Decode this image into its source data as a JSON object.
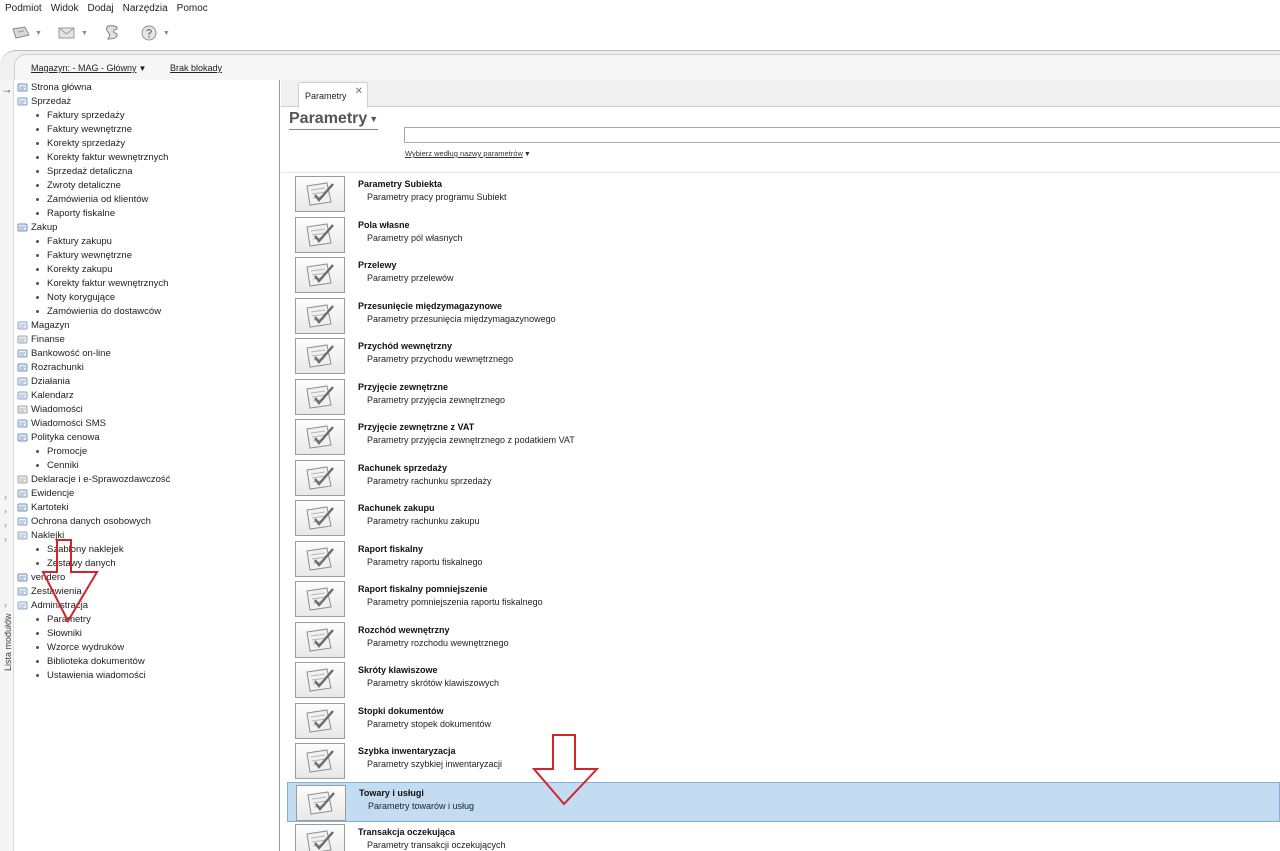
{
  "menu": [
    "Podmiot",
    "Widok",
    "Dodaj",
    "Narzędzia",
    "Pomoc"
  ],
  "toolbar": {
    "buttons": [
      {
        "icon": "document-arrow-icon",
        "has_caret": true
      },
      {
        "icon": "envelope-icon",
        "has_caret": true
      },
      {
        "icon": "scroll-icon",
        "has_caret": false
      },
      {
        "icon": "help-question-icon",
        "has_caret": true
      }
    ]
  },
  "status": {
    "warehouse": "Magazyn: - MAG - Główny",
    "lock": "Brak blokady"
  },
  "sidebar": {
    "vertical_label": "Lista modułów",
    "tree": [
      {
        "label": "Strona główna",
        "level": 0,
        "icon": "home-icon"
      },
      {
        "label": "Sprzedaż",
        "level": 0,
        "icon": "sales-icon"
      },
      {
        "label": "Faktury sprzedaży",
        "level": 1
      },
      {
        "label": "Faktury wewnętrzne",
        "level": 1
      },
      {
        "label": "Korekty sprzedaży",
        "level": 1
      },
      {
        "label": "Korekty faktur wewnętrznych",
        "level": 1
      },
      {
        "label": "Sprzedaż detaliczna",
        "level": 1
      },
      {
        "label": "Zwroty detaliczne",
        "level": 1
      },
      {
        "label": "Zamówienia od klientów",
        "level": 1
      },
      {
        "label": "Raporty fiskalne",
        "level": 1
      },
      {
        "label": "Zakup",
        "level": 0,
        "icon": "purchase-icon"
      },
      {
        "label": "Faktury zakupu",
        "level": 1
      },
      {
        "label": "Faktury wewnętrzne",
        "level": 1
      },
      {
        "label": "Korekty zakupu",
        "level": 1
      },
      {
        "label": "Korekty faktur wewnętrznych",
        "level": 1
      },
      {
        "label": "Noty korygujące",
        "level": 1
      },
      {
        "label": "Zamówienia do dostawców",
        "level": 1
      },
      {
        "label": "Magazyn",
        "level": 0,
        "icon": "warehouse-icon"
      },
      {
        "label": "Finanse",
        "level": 0,
        "icon": "finance-icon"
      },
      {
        "label": "Bankowość on-line",
        "level": 0,
        "icon": "bank-icon"
      },
      {
        "label": "Rozrachunki",
        "level": 0,
        "icon": "settlements-icon"
      },
      {
        "label": "Działania",
        "level": 0,
        "icon": "actions-icon"
      },
      {
        "label": "Kalendarz",
        "level": 0,
        "icon": "calendar-icon"
      },
      {
        "label": "Wiadomości",
        "level": 0,
        "icon": "messages-icon"
      },
      {
        "label": "Wiadomości SMS",
        "level": 0,
        "icon": "sms-icon"
      },
      {
        "label": "Polityka cenowa",
        "level": 0,
        "icon": "pricing-icon"
      },
      {
        "label": "Promocje",
        "level": 1
      },
      {
        "label": "Cenniki",
        "level": 1
      },
      {
        "label": "Deklaracje i e-Sprawozdawczość",
        "level": 0,
        "icon": "declarations-icon"
      },
      {
        "label": "Ewidencje",
        "level": 0,
        "icon": "records-icon"
      },
      {
        "label": "Kartoteki",
        "level": 0,
        "icon": "files-icon"
      },
      {
        "label": "Ochrona danych osobowych",
        "level": 0,
        "icon": "shield-icon"
      },
      {
        "label": "Naklejki",
        "level": 0,
        "icon": "stickers-icon"
      },
      {
        "label": "Szablony naklejek",
        "level": 1
      },
      {
        "label": "Zestawy danych",
        "level": 1
      },
      {
        "label": "vendero",
        "level": 0,
        "icon": "vendero-icon"
      },
      {
        "label": "Zestawienia",
        "level": 0,
        "icon": "reports-icon"
      },
      {
        "label": "Administracja",
        "level": 0,
        "icon": "admin-icon"
      },
      {
        "label": "Parametry",
        "level": 1
      },
      {
        "label": "Słowniki",
        "level": 1
      },
      {
        "label": "Wzorce wydruków",
        "level": 1
      },
      {
        "label": "Biblioteka dokumentów",
        "level": 1
      },
      {
        "label": "Ustawienia wiadomości",
        "level": 1
      }
    ]
  },
  "main": {
    "tab_label": "Parametry",
    "title": "Parametry",
    "search_value": "",
    "filter_label": "Wybierz według nazwy parametrów",
    "selected_index": 15,
    "parameters": [
      {
        "name": "Parametry Subiekta",
        "desc": "Parametry pracy programu Subiekt"
      },
      {
        "name": "Pola własne",
        "desc": "Parametry pól własnych"
      },
      {
        "name": "Przelewy",
        "desc": "Parametry przelewów"
      },
      {
        "name": "Przesunięcie międzymagazynowe",
        "desc": "Parametry przesunięcia międzymagazynowego"
      },
      {
        "name": "Przychód wewnętrzny",
        "desc": "Parametry przychodu wewnętrznego"
      },
      {
        "name": "Przyjęcie zewnętrzne",
        "desc": "Parametry przyjęcia zewnętrznego"
      },
      {
        "name": "Przyjęcie zewnętrzne z VAT",
        "desc": "Parametry przyjęcia zewnętrznego z podatkiem VAT"
      },
      {
        "name": "Rachunek sprzedaży",
        "desc": "Parametry rachunku sprzedaży"
      },
      {
        "name": "Rachunek zakupu",
        "desc": "Parametry rachunku zakupu"
      },
      {
        "name": "Raport fiskalny",
        "desc": "Parametry raportu fiskalnego"
      },
      {
        "name": "Raport fiskalny pomniejszenie",
        "desc": "Parametry pomniejszenia raportu fiskalnego"
      },
      {
        "name": "Rozchód wewnętrzny",
        "desc": "Parametry rozchodu wewnętrznego"
      },
      {
        "name": "Skróty klawiszowe",
        "desc": "Parametry skrótów klawiszowych"
      },
      {
        "name": "Stopki dokumentów",
        "desc": "Parametry stopek dokumentów"
      },
      {
        "name": "Szybka inwentaryzacja",
        "desc": "Parametry szybkiej inwentaryzacji"
      },
      {
        "name": "Towary i usługi",
        "desc": "Parametry towarów i usług"
      },
      {
        "name": "Transakcja oczekująca",
        "desc": "Parametry transakcji oczekujących"
      }
    ]
  },
  "colors": {
    "selection": "#c3dcf2",
    "selection_border": "#7fb2dc",
    "annotation_arrow": "#d0262b"
  }
}
